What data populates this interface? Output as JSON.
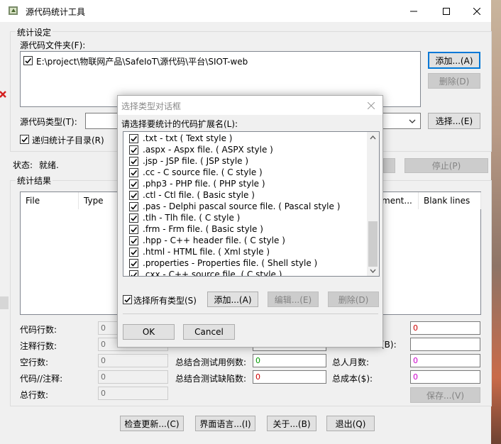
{
  "window": {
    "title": "源代码统计工具"
  },
  "settings": {
    "group_label": "统计设定",
    "folder_label": "源代码文件夹(F):",
    "folder_entry": "E:\\project\\物联网产品\\SafeIoT\\源代码\\平台\\SIOT-web",
    "add_button": "添加...(A)",
    "delete_button": "删除(D)",
    "type_label": "源代码类型(T):",
    "select_button": "选择...(E)",
    "recursive_label": "递归统计子目录(R)",
    "stop_button": "停止(P)"
  },
  "status": {
    "label": "状态:",
    "value": "就绪."
  },
  "results": {
    "group_label": "统计结果",
    "columns": [
      "File",
      "Type",
      "ment...",
      "Blank lines"
    ],
    "left_stats": [
      {
        "label": "代码行数:",
        "value": "0"
      },
      {
        "label": "注释行数:",
        "value": "0"
      },
      {
        "label": "空行数:",
        "value": "0"
      },
      {
        "label": "代码//注释:",
        "value": "0"
      },
      {
        "label": "总行数:",
        "value": "0"
      }
    ],
    "mid_stats": [
      {
        "label": "总结合测试用例数:",
        "value": "0"
      },
      {
        "label": "总结合测试缺陷数:",
        "value": "0"
      }
    ],
    "right_stats": [
      {
        "label": "总人月数:",
        "value": "0"
      },
      {
        "label": "总成本($):",
        "value": "0"
      }
    ],
    "top_right_value": "0",
    "partial_b_label": "(B):",
    "save_button": "保存...(V)"
  },
  "bottom_buttons": {
    "check_update": "检查更新...(C)",
    "ui_language": "界面语言...(I)",
    "about": "关于...(B)",
    "exit": "退出(Q)"
  },
  "dialog": {
    "title": "选择类型对话框",
    "prompt": "请选择要统计的代码扩展名(L):",
    "items": [
      ".txt - txt ( Text style )",
      ".aspx - Aspx file. ( ASPX style )",
      ".jsp - JSP file. ( JSP style )",
      ".cc - C source file. ( C style )",
      ".php3 - PHP file. ( PHP style )",
      ".ctl - Ctl file. ( Basic style )",
      ".pas - Delphi pascal source file. ( Pascal style )",
      ".tlh - Tlh file. ( C style )",
      ".frm - Frm file. ( Basic style )",
      ".hpp - C++ header file. ( C style )",
      ".html - HTML file. ( Xml style )",
      ".properties - Properties file. ( Shell style )",
      ".cxx - C++ source file. ( C style )"
    ],
    "select_all_label": "选择所有类型(S)",
    "add_button": "添加...(A)",
    "edit_button": "编辑...(E)",
    "delete_button": "删除(D)",
    "ok_button": "OK",
    "cancel_button": "Cancel"
  },
  "colors": {
    "accent": "#0078d7",
    "value_green": "#009900",
    "value_red": "#cc0000",
    "value_purple": "#cc00cc",
    "disabled_text": "#838383"
  }
}
